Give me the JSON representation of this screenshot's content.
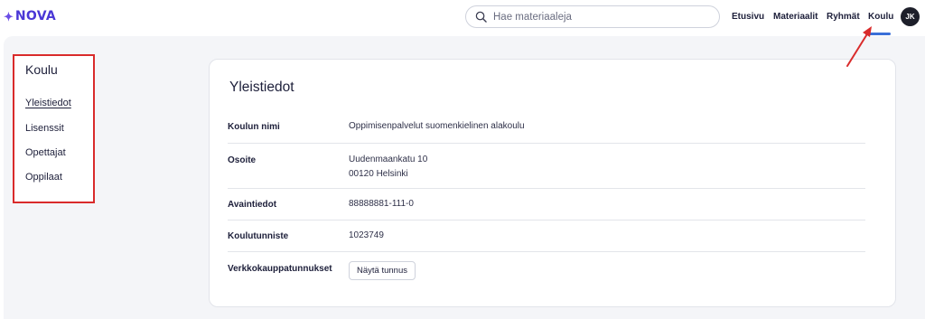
{
  "header": {
    "logo_text": "NOVA",
    "search_placeholder": "Hae materiaaleja",
    "nav": [
      "Etusivu",
      "Materiaalit",
      "Ryhmät",
      "Koulu"
    ],
    "active_nav": "Koulu",
    "avatar_initials": "JK"
  },
  "sidebar": {
    "title": "Koulu",
    "items": [
      "Yleistiedot",
      "Lisenssit",
      "Opettajat",
      "Oppilaat"
    ],
    "active_item": "Yleistiedot"
  },
  "card": {
    "title": "Yleistiedot",
    "rows": [
      {
        "label": "Koulun nimi",
        "value": "Oppimisenpalvelut suomenkielinen alakoulu"
      },
      {
        "label": "Osoite",
        "value_line1": "Uudenmaankatu 10",
        "value_line2": "00120 Helsinki"
      },
      {
        "label": "Avaintiedot",
        "value": "88888881-111-0"
      },
      {
        "label": "Koulutunniste",
        "value": "1023749"
      },
      {
        "label": "Verkkokauppatunnukset",
        "button_label": "Näytä tunnus"
      }
    ]
  },
  "colors": {
    "brand": "#4a37d6",
    "highlight_border": "#d92b2b",
    "active_tab": "#3a6fd8"
  }
}
